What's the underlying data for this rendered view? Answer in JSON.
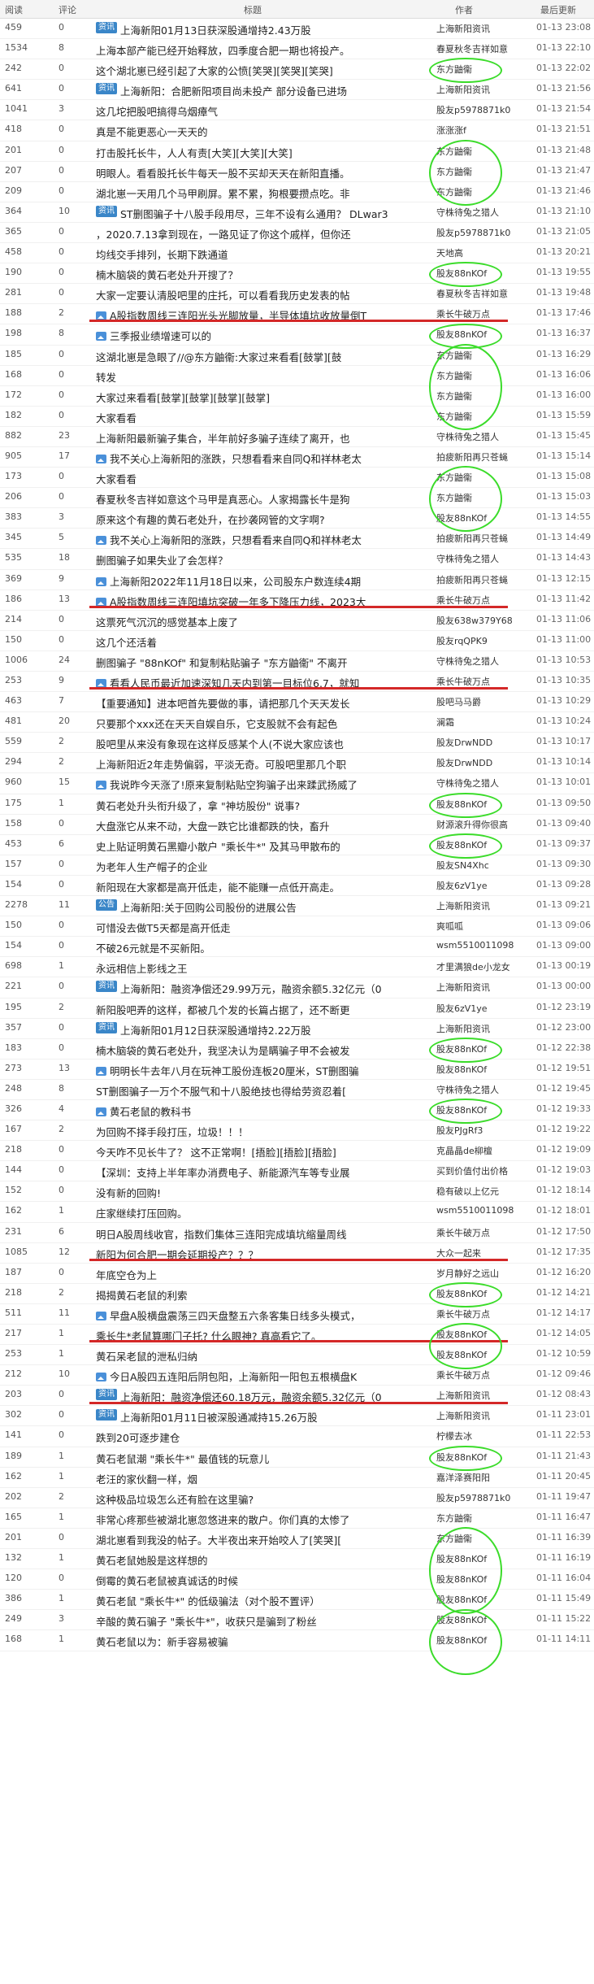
{
  "header": {
    "read": "阅读",
    "comments": "评论",
    "title": "标题",
    "author": "作者",
    "updated": "最后更新"
  },
  "rows": [
    {
      "read": "459",
      "cmt": "0",
      "tag": "资讯",
      "title": "上海新阳01月13日获深股通增持2.43万股",
      "author": "上海新阳资讯",
      "time": "01-13 23:08"
    },
    {
      "read": "1534",
      "cmt": "8",
      "title": "上海本部产能已经开始释放，四季度合肥一期也将投产。",
      "author": "春夏秋冬吉祥如意",
      "time": "01-13 22:10"
    },
    {
      "read": "242",
      "cmt": "0",
      "title": "这个湖北崽已经引起了大家的公愤[笑哭][笑哭][笑哭]",
      "author": "东方鼬衞",
      "time": "01-13 22:02"
    },
    {
      "read": "641",
      "cmt": "0",
      "tag": "资讯",
      "title": "上海新阳：合肥新阳项目尚未投产 部分设备已进场",
      "author": "上海新阳资讯",
      "time": "01-13 21:56"
    },
    {
      "read": "1041",
      "cmt": "3",
      "title": "这几坨把股吧搞得乌烟瘴气",
      "author": "股友p5978871k0",
      "time": "01-13 21:54"
    },
    {
      "read": "418",
      "cmt": "0",
      "title": "真是不能更恶心一天天的",
      "author": "涨涨涨f",
      "time": "01-13 21:51"
    },
    {
      "read": "201",
      "cmt": "0",
      "title": "打击股托长牛，人人有责[大笑][大笑][大笑]",
      "author": "东方鼬衞",
      "time": "01-13 21:48"
    },
    {
      "read": "207",
      "cmt": "0",
      "title": "明眼人。看看股托长牛每天一股不买却天天在新阳直播。",
      "author": "东方鼬衞",
      "time": "01-13 21:47"
    },
    {
      "read": "209",
      "cmt": "0",
      "title": "湖北崽一天用几个马甲刷屏。累不累，狗根要攒点吃。非",
      "author": "东方鼬衞",
      "time": "01-13 21:46"
    },
    {
      "read": "364",
      "cmt": "10",
      "tag": "资讯",
      "title": "ST删图骗子十八股手段用尽，三年不设有么通用？ DLwar3",
      "author": "守株待兔之猎人",
      "time": "01-13 21:10"
    },
    {
      "read": "365",
      "cmt": "0",
      "title": "，2020.7.13拿到现在，一路见证了你这个戚样，但你还",
      "author": "股友p5978871k0",
      "time": "01-13 21:05"
    },
    {
      "read": "458",
      "cmt": "0",
      "title": "均线交手排列，长期下跌通道",
      "author": "天地高",
      "time": "01-13 20:21"
    },
    {
      "read": "190",
      "cmt": "0",
      "title": "楠木脑袋的黄石老处升开搜了？",
      "author": "股友88nKOf",
      "time": "01-13 19:55"
    },
    {
      "read": "281",
      "cmt": "0",
      "title": "大家一定要认清股吧里的庄托，可以看看我历史发表的帖",
      "author": "春夏秋冬吉祥如意",
      "time": "01-13 19:48"
    },
    {
      "read": "188",
      "cmt": "2",
      "pic": true,
      "title": "A股指数周线三连阳光头光脚放量，半导体填坑收放量倒T",
      "author": "乘长牛破万点",
      "time": "01-13 17:46"
    },
    {
      "read": "198",
      "cmt": "8",
      "pic": true,
      "title": "三季报业绩增速可以的",
      "author": "股友88nKOf",
      "time": "01-13 16:37"
    },
    {
      "read": "185",
      "cmt": "0",
      "title": "这湖北崽是急眼了//@东方鼬衞:大家过来看看[鼓掌][鼓",
      "author": "东方鼬衞",
      "time": "01-13 16:29"
    },
    {
      "read": "168",
      "cmt": "0",
      "title": "转发",
      "author": "东方鼬衞",
      "time": "01-13 16:06"
    },
    {
      "read": "172",
      "cmt": "0",
      "title": "大家过来看看[鼓掌][鼓掌][鼓掌][鼓掌]",
      "author": "东方鼬衞",
      "time": "01-13 16:00"
    },
    {
      "read": "182",
      "cmt": "0",
      "title": "大家看看",
      "author": "东方鼬衞",
      "time": "01-13 15:59"
    },
    {
      "read": "882",
      "cmt": "23",
      "title": "上海新阳最新骗子集合，半年前好多骗子连续了离开，也",
      "author": "守株待兔之猎人",
      "time": "01-13 15:45"
    },
    {
      "read": "905",
      "cmt": "17",
      "pic": true,
      "title": "我不关心上海新阳的涨跌，只想看看来自同Q和祥林老太",
      "author": "拍疲新阳再只苍蝇",
      "time": "01-13 15:14"
    },
    {
      "read": "173",
      "cmt": "0",
      "title": "大家看看",
      "author": "东方鼬衞",
      "time": "01-13 15:08"
    },
    {
      "read": "206",
      "cmt": "0",
      "title": "春夏秋冬吉祥如意这个马甲是真恶心。人家揭露长牛是狗",
      "author": "东方鼬衞",
      "time": "01-13 15:03"
    },
    {
      "read": "383",
      "cmt": "3",
      "title": "原来这个有趣的黄石老处升，在抄袭网管的文字啊?",
      "author": "股友88nKOf",
      "time": "01-13 14:55"
    },
    {
      "read": "345",
      "cmt": "5",
      "pic": true,
      "title": "我不关心上海新阳的涨跌，只想看看来自同Q和祥林老太",
      "author": "拍疲新阳再只苍蝇",
      "time": "01-13 14:49"
    },
    {
      "read": "535",
      "cmt": "18",
      "title": "删图骗子如果失业了会怎样？",
      "author": "守株待兔之猎人",
      "time": "01-13 14:43"
    },
    {
      "read": "369",
      "cmt": "9",
      "pic": true,
      "title": "上海新阳2022年11月18日以来，公司股东户数连续4期",
      "author": "拍疲新阳再只苍蝇",
      "time": "01-13 12:15"
    },
    {
      "read": "186",
      "cmt": "13",
      "pic": true,
      "title": "A股指数周线三连阳填坑突破一年多下降压力线，2023大",
      "author": "乘长牛破万点",
      "time": "01-13 11:42"
    },
    {
      "read": "214",
      "cmt": "0",
      "title": "这票死气沉沉的感觉基本上废了",
      "author": "股友638w379Y68",
      "time": "01-13 11:06"
    },
    {
      "read": "150",
      "cmt": "0",
      "title": "这几个还活着",
      "author": "股友rqQPK9",
      "time": "01-13 11:00"
    },
    {
      "read": "1006",
      "cmt": "24",
      "title": "删图骗子 \"88nKOf\" 和复制粘贴骗子 \"东方鼬衞\" 不离开",
      "author": "守株待兔之猎人",
      "time": "01-13 10:53"
    },
    {
      "read": "253",
      "cmt": "9",
      "pic": true,
      "title": "看看人民币最近加速深知几天内到第一目标位6.7，就知",
      "author": "乘长牛破万点",
      "time": "01-13 10:35"
    },
    {
      "read": "463",
      "cmt": "7",
      "title": "【重要通知】进本吧首先要做的事，请把那几个天天发长",
      "author": "股吧马马爵",
      "time": "01-13 10:29"
    },
    {
      "read": "481",
      "cmt": "20",
      "title": "只要那个xxx还在天天自娱自乐，它支股就不会有起色",
      "author": "澜霜",
      "time": "01-13 10:24"
    },
    {
      "read": "559",
      "cmt": "2",
      "title": "股吧里从来没有象现在这样反感某个人(不说大家应该也",
      "author": "股友DrwNDD",
      "time": "01-13 10:17"
    },
    {
      "read": "294",
      "cmt": "2",
      "title": "上海新阳近2年走势偏弱，平淡无奇。可股吧里那几个职",
      "author": "股友DrwNDD",
      "time": "01-13 10:14"
    },
    {
      "read": "960",
      "cmt": "15",
      "pic": true,
      "title": "我说昨今天涨了!原来复制粘贴空狗骗子出来蹂武扬威了",
      "author": "守株待兔之猎人",
      "time": "01-13 10:01"
    },
    {
      "read": "175",
      "cmt": "1",
      "title": "黄石老处升头衔升级了，拿 \"神坊股份\" 说事?",
      "author": "股友88nKOf",
      "time": "01-13 09:50"
    },
    {
      "read": "158",
      "cmt": "0",
      "title": "大盘涨它从来不动，大盘一跌它比谁都跌的快，畜升",
      "author": "财源滚升得你很高",
      "time": "01-13 09:40"
    },
    {
      "read": "453",
      "cmt": "6",
      "title": "史上贴证明黄石黑瓣小散户 \"乘长牛*\" 及其马甲散布的",
      "author": "股友88nKOf",
      "time": "01-13 09:37"
    },
    {
      "read": "157",
      "cmt": "0",
      "title": "为老年人生产帽子的企业",
      "author": "股友SN4Xhc",
      "time": "01-13 09:30"
    },
    {
      "read": "154",
      "cmt": "0",
      "title": "新阳现在大家都是高开低走，能不能赚一点低开高走。",
      "author": "股友6zV1ye",
      "time": "01-13 09:28"
    },
    {
      "read": "2278",
      "cmt": "11",
      "tag": "公告",
      "title": "上海新阳:关于回购公司股份的进展公告",
      "author": "上海新阳资讯",
      "time": "01-13 09:21"
    },
    {
      "read": "150",
      "cmt": "0",
      "title": "可惜没去做T5天都是高开低走",
      "author": "爽呱呱",
      "time": "01-13 09:06"
    },
    {
      "read": "154",
      "cmt": "0",
      "title": "不破26元就是不买新阳。",
      "author": "wsm5510011098",
      "time": "01-13 09:00"
    },
    {
      "read": "698",
      "cmt": "1",
      "title": "永远相信上影线之王",
      "author": "才里满狼de小龙女",
      "time": "01-13 00:19"
    },
    {
      "read": "221",
      "cmt": "0",
      "tag": "资讯",
      "title": "上海新阳：融资净偿还29.99万元，融资余额5.32亿元（0",
      "author": "上海新阳资讯",
      "time": "01-13 00:00"
    },
    {
      "read": "195",
      "cmt": "2",
      "title": "新阳股吧弄的这样，都被几个发的长篇占据了，还不断更",
      "author": "股友6zV1ye",
      "time": "01-12 23:19"
    },
    {
      "read": "357",
      "cmt": "0",
      "tag": "资讯",
      "title": "上海新阳01月12日获深股通增持2.22万股",
      "author": "上海新阳资讯",
      "time": "01-12 23:00"
    },
    {
      "read": "183",
      "cmt": "0",
      "title": "楠木脑袋的黄石老处升，我坚决认为是瞒骗子甲不会被发",
      "author": "股友88nKOf",
      "time": "01-12 22:38"
    },
    {
      "read": "273",
      "cmt": "13",
      "pic": true,
      "title": "明明长牛去年八月在玩神工股份连板20厘米，ST删图骗",
      "author": "股友88nKOf",
      "time": "01-12 19:51"
    },
    {
      "read": "248",
      "cmt": "8",
      "title": "ST删图骗子一万个不服气和十八股绝技也得给劳资忍着[",
      "author": "守株待兔之猎人",
      "time": "01-12 19:45"
    },
    {
      "read": "326",
      "cmt": "4",
      "pic": true,
      "title": "黄石老鼠的教科书",
      "author": "股友88nKOf",
      "time": "01-12 19:33"
    },
    {
      "read": "167",
      "cmt": "2",
      "title": "为回购不择手段打压，垃圾！！！",
      "author": "股友PJgRf3",
      "time": "01-12 19:22"
    },
    {
      "read": "218",
      "cmt": "0",
      "title": "今天咋不见长牛了？ 这不正常啊！[捂脸][捂脸][捂脸]",
      "author": "克晶晶de柳檀",
      "time": "01-12 19:09"
    },
    {
      "read": "144",
      "cmt": "0",
      "title": "【深圳：支持上半年率办消费电子、新能源汽车等专业展",
      "author": "买到价值付出价格",
      "time": "01-12 19:03"
    },
    {
      "read": "152",
      "cmt": "0",
      "title": "没有新的回购!",
      "author": "稳有破以上亿元",
      "time": "01-12 18:14"
    },
    {
      "read": "162",
      "cmt": "1",
      "title": "庄家继续打压回购。",
      "author": "wsm5510011098",
      "time": "01-12 18:01"
    },
    {
      "read": "231",
      "cmt": "6",
      "title": "明日A股周线收官，指数们集体三连阳完成填坑缩量周线",
      "author": "乘长牛破万点",
      "time": "01-12 17:50"
    },
    {
      "read": "1085",
      "cmt": "12",
      "title": "新阳为何合肥一期会延期投产？？？",
      "author": "大众一起来",
      "time": "01-12 17:35"
    },
    {
      "read": "187",
      "cmt": "0",
      "title": "年底空仓为上",
      "author": "岁月静好之远山",
      "time": "01-12 16:20"
    },
    {
      "read": "218",
      "cmt": "2",
      "title": "揭揭黄石老鼠的利索",
      "author": "股友88nKOf",
      "time": "01-12 14:21"
    },
    {
      "read": "511",
      "cmt": "11",
      "pic": true,
      "title": "早盘A股横盘震荡三四天盘整五六条客集日线多头模式，",
      "author": "乘长牛破万点",
      "time": "01-12 14:17"
    },
    {
      "read": "217",
      "cmt": "1",
      "title": "乘长牛*老鼠算哪门子托? 什么眼神? 真高看它了。",
      "author": "股友88nKOf",
      "time": "01-12 14:05"
    },
    {
      "read": "253",
      "cmt": "1",
      "title": "黄石呆老鼠的泄私归纳",
      "author": "股友88nKOf",
      "time": "01-12 10:59"
    },
    {
      "read": "212",
      "cmt": "10",
      "pic": true,
      "title": "今日A股四五连阳后阴包阳，上海新阳一阳包五根横盘K",
      "author": "乘长牛破万点",
      "time": "01-12 09:46"
    },
    {
      "read": "203",
      "cmt": "0",
      "tag": "资讯",
      "title": "上海新阳：融资净偿还60.18万元，融资余额5.32亿元（0",
      "author": "上海新阳资讯",
      "time": "01-12 08:43"
    },
    {
      "read": "302",
      "cmt": "0",
      "tag": "资讯",
      "title": "上海新阳01月11日被深股通减持15.26万股",
      "author": "上海新阳资讯",
      "time": "01-11 23:01"
    },
    {
      "read": "141",
      "cmt": "0",
      "title": "跌到20可逐步建仓",
      "author": "柠檬去冰",
      "time": "01-11 22:53"
    },
    {
      "read": "189",
      "cmt": "1",
      "title": "黄石老鼠潮 \"乘长牛*\" 最值钱的玩意儿",
      "author": "股友88nKOf",
      "time": "01-11 21:43"
    },
    {
      "read": "162",
      "cmt": "1",
      "title": "老汪的家伙翻一样，烟",
      "author": "嘉洋泽赛阳阳",
      "time": "01-11 20:45"
    },
    {
      "read": "202",
      "cmt": "2",
      "title": "这种极品垃圾怎么还有脸在这里骗?",
      "author": "股友p5978871k0",
      "time": "01-11 19:47"
    },
    {
      "read": "165",
      "cmt": "1",
      "title": "非常心疼那些被湖北崽忽悠进来的散户。你们真的太惨了",
      "author": "东方鼬衞",
      "time": "01-11 16:47"
    },
    {
      "read": "201",
      "cmt": "0",
      "title": "湖北崽看到我没的帖子。大半夜出来开始咬人了[笑哭][",
      "author": "东方鼬衞",
      "time": "01-11 16:39"
    },
    {
      "read": "132",
      "cmt": "1",
      "title": "黄石老鼠她股是这样想的",
      "author": "股友88nKOf",
      "time": "01-11 16:19"
    },
    {
      "read": "120",
      "cmt": "0",
      "title": "倒霉的黄石老鼠被真诚话的时候",
      "author": "股友88nKOf",
      "time": "01-11 16:04"
    },
    {
      "read": "386",
      "cmt": "1",
      "title": "黄石老鼠 \"乘长牛*\" 的低级骗法（对个股不置评）",
      "author": "股友88nKOf",
      "time": "01-11 15:49"
    },
    {
      "read": "249",
      "cmt": "3",
      "title": "辛酸的黄石骗子 \"乘长牛*\"，收获只是骗到了粉丝",
      "author": "股友88nKOf",
      "time": "01-11 15:22"
    },
    {
      "read": "168",
      "cmt": "1",
      "title": "黄石老鼠以为：新手容易被骗",
      "author": "股友88nKOf",
      "time": "01-11 14:11"
    }
  ]
}
